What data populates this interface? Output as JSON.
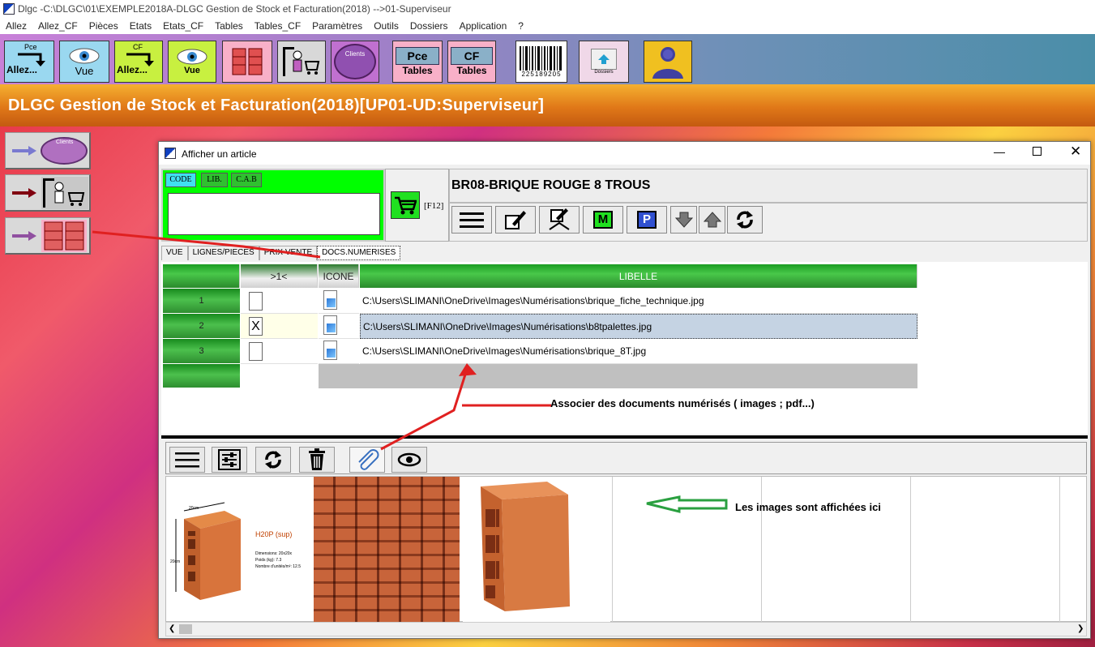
{
  "window": {
    "title": "Dlgc -C:\\DLGC\\01\\EXEMPLE2018A-DLGC Gestion de Stock et Facturation(2018) -->01-Superviseur"
  },
  "menu": [
    "Allez",
    "Allez_CF",
    "Pièces",
    "Etats",
    "Etats_CF",
    "Tables",
    "Tables_CF",
    "Paramètres",
    "Outils",
    "Dossiers",
    "Application",
    "?"
  ],
  "toolbar": {
    "pce_label": "Pce",
    "allez_label": "Allez...",
    "vue_label": "Vue",
    "cf_label": "CF",
    "clients_label": "Clients",
    "tables_label": "Tables",
    "barcode_text": "225189205",
    "dossiers_label": "Dossiers"
  },
  "banner": {
    "title": "DLGC Gestion de Stock et Facturation(2018)[UP01-UD:Superviseur]"
  },
  "side": {
    "clients_label": "Clients"
  },
  "dialog": {
    "title": "Afficher un article",
    "code_tabs": [
      "CODE",
      "LIB.",
      "C.A.B"
    ],
    "search_value": "",
    "f12_label": "[F12]",
    "article_title": "BR08-BRIQUE ROUGE 8 TROUS",
    "m_label": "M",
    "p_label": "P",
    "tabs": [
      "VUE",
      "LIGNES/PIECES",
      "PRIX VENTE",
      "DOCS.NUMERISES"
    ],
    "grid": {
      "headers": [
        "",
        ">1<",
        "ICONE",
        "LIBELLE"
      ],
      "rows": [
        {
          "no": "1",
          "checked": "",
          "path": "C:\\Users\\SLIMANI\\OneDrive\\Images\\Numérisations\\brique_fiche_technique.jpg"
        },
        {
          "no": "2",
          "checked": "X",
          "path": "C:\\Users\\SLIMANI\\OneDrive\\Images\\Numérisations\\b8tpalettes.jpg"
        },
        {
          "no": "3",
          "checked": "",
          "path": "C:\\Users\\SLIMANI\\OneDrive\\Images\\Numérisations\\brique_8T.jpg"
        }
      ]
    },
    "note_documents": "Associer des documents numérisés ( images ; pdf...)",
    "note_images": "Les images sont affichées ici",
    "fiche": {
      "title": "H20P (sup)",
      "line1": "Dimensions: 20x20x",
      "line2": "Poids (kg): 7.3",
      "line3": "Nombre d'unités/m²: 12.5",
      "dim_a": "20cm",
      "dim_b": "20cm"
    }
  },
  "colors": {
    "banner": "#e07818",
    "panel_green": "#00ff00",
    "grid_header": "#2a9a2e",
    "selected_row": "#c5d3e3",
    "arrow_red": "#e02020",
    "arrow_green": "#2aa040"
  }
}
